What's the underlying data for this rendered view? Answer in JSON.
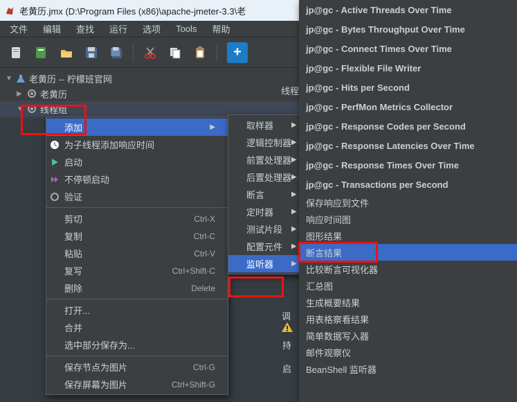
{
  "window": {
    "title": "老黄历.jmx (D:\\Program Files (x86)\\apache-jmeter-3.3\\老"
  },
  "menubar": [
    "文件",
    "编辑",
    "查找",
    "运行",
    "选项",
    "Tools",
    "帮助"
  ],
  "tree": {
    "root": "老黄历 -- 柠檬班官网",
    "c1": "老黄历",
    "c2": "线程组"
  },
  "context": {
    "add": "添加",
    "add_resp_time": "为子线程添加响应时间",
    "start": "启动",
    "start_no_pause": "不停顿启动",
    "validate": "验证",
    "cut": "剪切",
    "cut_sc": "Ctrl-X",
    "copy": "复制",
    "copy_sc": "Ctrl-C",
    "paste": "粘贴",
    "paste_sc": "Ctrl-V",
    "duplicate": "复写",
    "dup_sc": "Ctrl+Shift-C",
    "delete": "删除",
    "del_sc": "Delete",
    "open": "打开...",
    "merge": "合并",
    "save_sel": "选中部分保存为...",
    "save_node_img": "保存节点为图片",
    "sni_sc": "Ctrl-G",
    "save_screen_img": "保存屏幕为图片",
    "ssi_sc": "Ctrl+Shift-G"
  },
  "submenu1": [
    "取样器",
    "逻辑控制器",
    "前置处理器",
    "后置处理器",
    "断言",
    "定时器",
    "测试片段",
    "配置元件",
    "监听器"
  ],
  "right_panel": {
    "thread_label": "线程",
    "tune_label": "调",
    "hold_label": "持",
    "start_label": "启"
  },
  "submenu2": {
    "jp": [
      "jp@gc - Active Threads Over Time",
      "jp@gc - Bytes Throughput Over Time",
      "jp@gc - Connect Times Over Time",
      "jp@gc - Flexible File Writer",
      "jp@gc - Hits per Second",
      "jp@gc - PerfMon Metrics Collector",
      "jp@gc - Response Codes per Second",
      "jp@gc - Response Latencies Over Time",
      "jp@gc - Response Times Over Time",
      "jp@gc - Transactions per Second"
    ],
    "rest": [
      "保存响应到文件",
      "响应时间图",
      "图形结果",
      "断言结果",
      "比较断言可视化器",
      "汇总图",
      "生成概要结果",
      "用表格察看结果",
      "简单数据写入器",
      "邮件观察仪",
      "BeanShell 监听器"
    ]
  }
}
